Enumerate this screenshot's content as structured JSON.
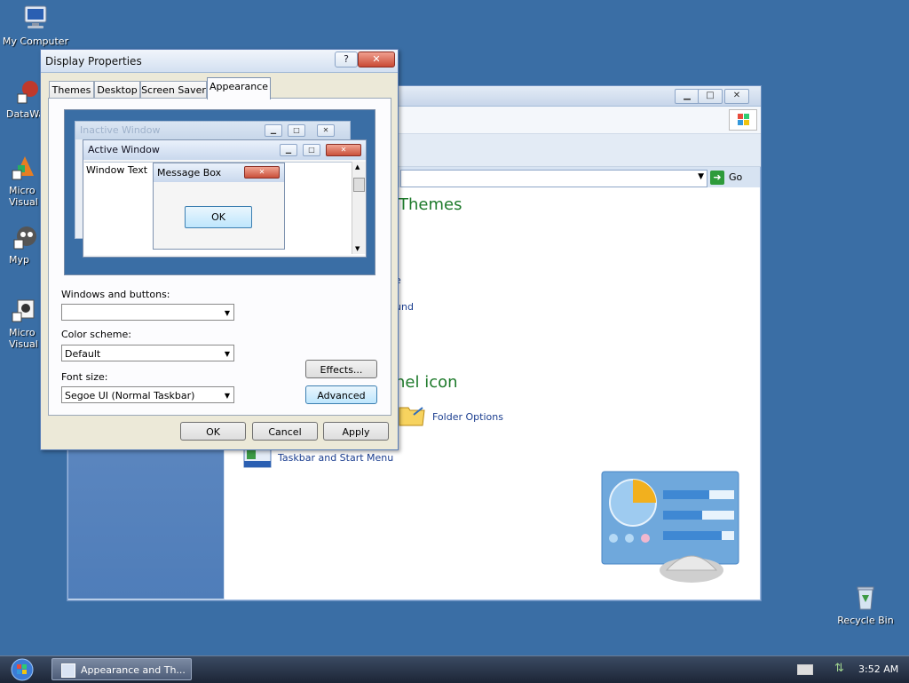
{
  "desktop": {
    "icons": [
      {
        "label": "My Computer"
      },
      {
        "label": "DataWa"
      },
      {
        "label": "Micro\nVisual"
      },
      {
        "label": "Myp"
      },
      {
        "label": "Micro\nVisual"
      },
      {
        "label": "Recycle Bin"
      }
    ]
  },
  "back_window": {
    "min_label": "▁",
    "max_label": "□",
    "close_label": "✕",
    "go_label": "Go",
    "headings": [
      "Themes",
      "nel icon"
    ],
    "links": [
      "e",
      "und",
      "Folder Options",
      "Taskbar and Start Menu"
    ]
  },
  "dialog": {
    "title": "Display Properties",
    "help_label": "?",
    "close_label": "✕",
    "tabs": [
      "Themes",
      "Desktop",
      "Screen Saver",
      "Appearance"
    ],
    "active_tab": "Appearance",
    "preview": {
      "inactive_title": "Inactive Window",
      "active_title": "Active Window",
      "window_text": "Window Text",
      "msgbox_title": "Message Box",
      "msgbox_ok": "OK"
    },
    "fields": {
      "windows_buttons_label": "Windows and buttons:",
      "windows_buttons_value": "",
      "color_scheme_label": "Color scheme:",
      "color_scheme_value": "Default",
      "font_size_label": "Font size:",
      "font_size_value": "Segoe UI (Normal Taskbar)"
    },
    "effects_label": "Effects...",
    "advanced_label": "Advanced",
    "ok_label": "OK",
    "cancel_label": "Cancel",
    "apply_label": "Apply"
  },
  "taskbar": {
    "task_label": "Appearance and Th...",
    "clock": "3:52 AM"
  }
}
